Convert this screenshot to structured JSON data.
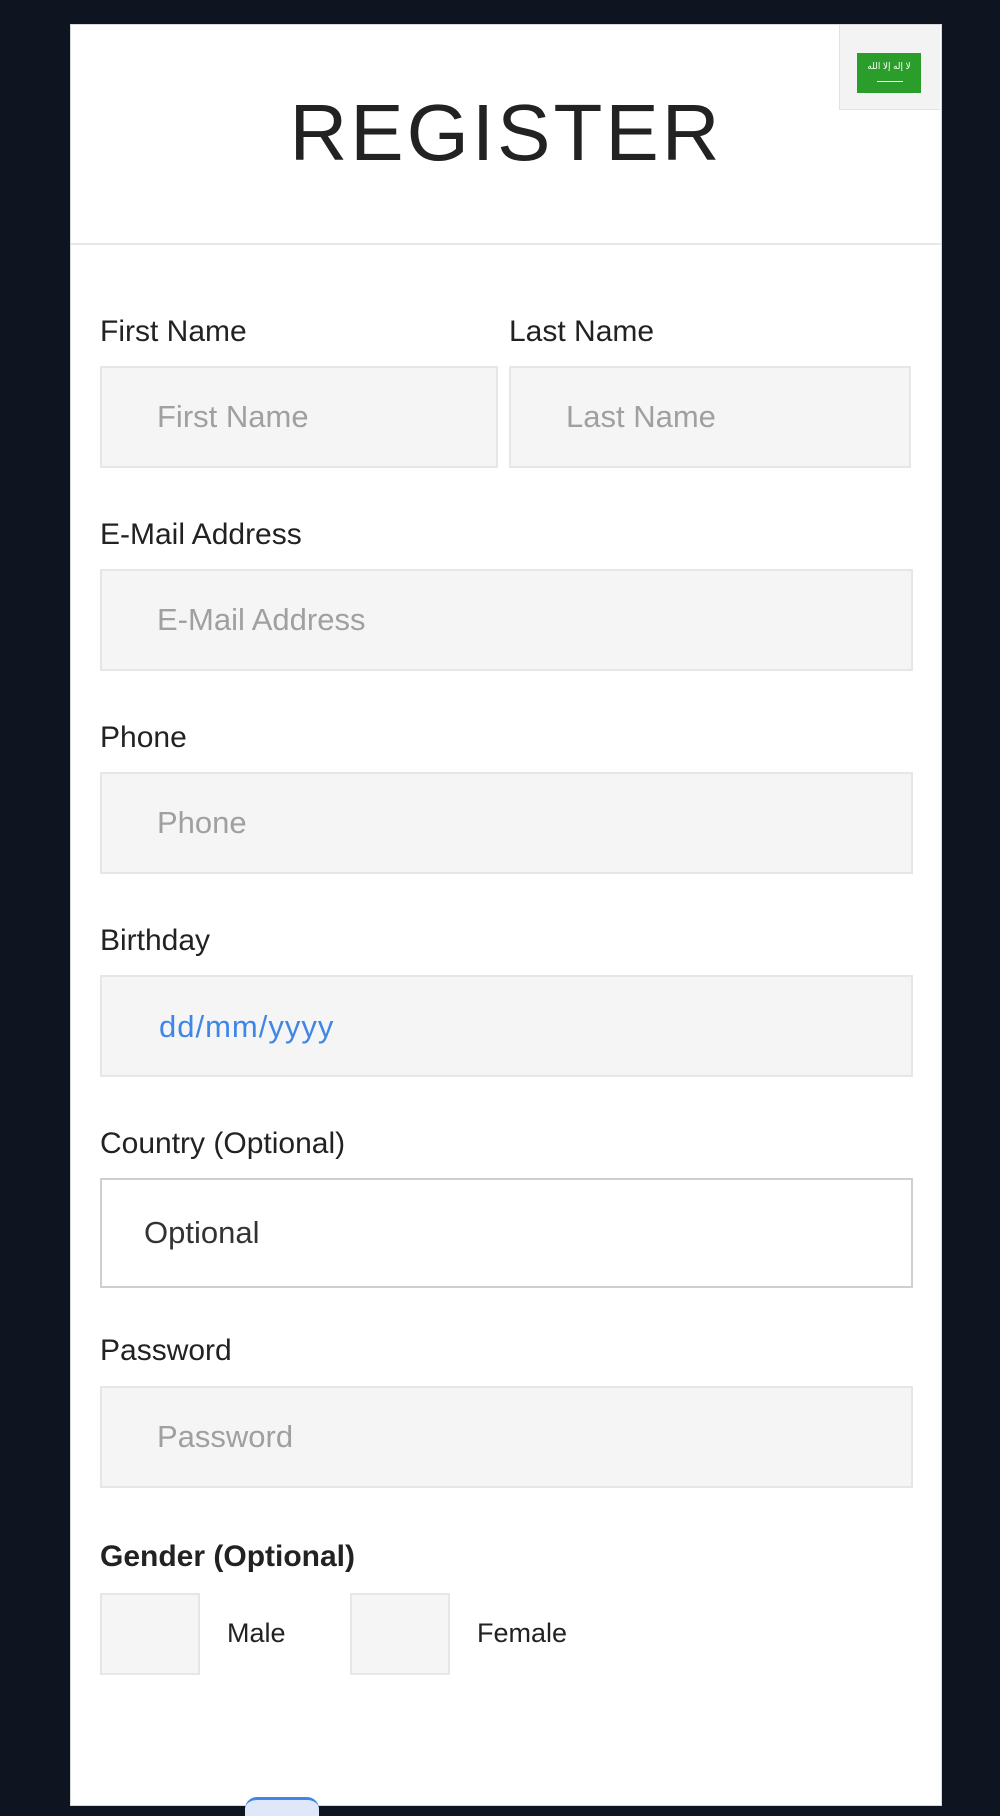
{
  "header": {
    "title": "REGISTER",
    "language_flag": {
      "icon": "saudi-flag-icon",
      "color": "#2a9d2a",
      "script": "ﻻ ﺇﻟﻪ ﺇﻻ ﺍﻟﻠﻪ"
    }
  },
  "form": {
    "first_name": {
      "label": "First Name",
      "placeholder": "First Name"
    },
    "last_name": {
      "label": "Last Name",
      "placeholder": "Last Name"
    },
    "email": {
      "label": "E-Mail Address",
      "placeholder": "E-Mail Address"
    },
    "phone": {
      "label": "Phone",
      "placeholder": "Phone"
    },
    "birthday": {
      "label": "Birthday",
      "placeholder": "dd/mm/yyyy"
    },
    "country": {
      "label": "Country (Optional)",
      "value": "Optional"
    },
    "password": {
      "label": "Password",
      "placeholder": "Password"
    },
    "gender": {
      "label": "Gender (Optional)",
      "options": [
        {
          "label": "Male"
        },
        {
          "label": "Female"
        }
      ]
    }
  },
  "colors": {
    "background": "#0e1420",
    "card": "#ffffff",
    "field_bg": "#f5f5f5",
    "date_accent": "#3f86e6"
  }
}
